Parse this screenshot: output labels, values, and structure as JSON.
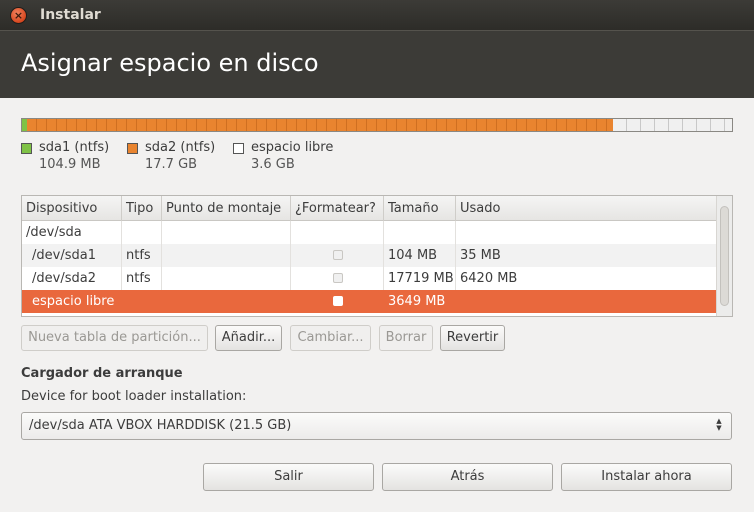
{
  "window": {
    "title": "Instalar",
    "close_glyph": "×"
  },
  "header": {
    "title": "Asignar espacio en disco"
  },
  "partition_bar": {
    "segments": [
      {
        "name": "sda1 (ntfs)",
        "size": "104.9 MB",
        "color": "#7fc246"
      },
      {
        "name": "sda2 (ntfs)",
        "size": "17.7 GB",
        "color": "#e9842f"
      },
      {
        "name": "espacio libre",
        "size": "3.6 GB",
        "color": "#f0f0f0"
      }
    ]
  },
  "table": {
    "columns": [
      "Dispositivo",
      "Tipo",
      "Punto de montaje",
      "¿Formatear?",
      "Tamaño",
      "Usado"
    ],
    "rows": [
      {
        "device": "/dev/sda",
        "type": "",
        "mount": "",
        "size": "",
        "used": ""
      },
      {
        "device": "/dev/sda1",
        "type": "ntfs",
        "mount": "",
        "size": "104 MB",
        "used": "35 MB"
      },
      {
        "device": "/dev/sda2",
        "type": "ntfs",
        "mount": "",
        "size": "17719 MB",
        "used": "6420 MB"
      },
      {
        "device": "espacio libre",
        "type": "",
        "mount": "",
        "size": "3649 MB",
        "used": ""
      }
    ]
  },
  "partition_buttons": {
    "new_table": "Nueva tabla de partición...",
    "add": "Añadir...",
    "change": "Cambiar...",
    "delete": "Borrar",
    "revert": "Revertir"
  },
  "bootloader": {
    "section_title": "Cargador de arranque",
    "device_label": "Device for boot loader installation:",
    "selected_device": "/dev/sda ATA VBOX HARDDISK (21.5 GB)"
  },
  "footer": {
    "quit": "Salir",
    "back": "Atrás",
    "install_now": "Instalar ahora"
  },
  "colors": {
    "accent": "#e9683d",
    "header_bg": "#3c3b37"
  }
}
